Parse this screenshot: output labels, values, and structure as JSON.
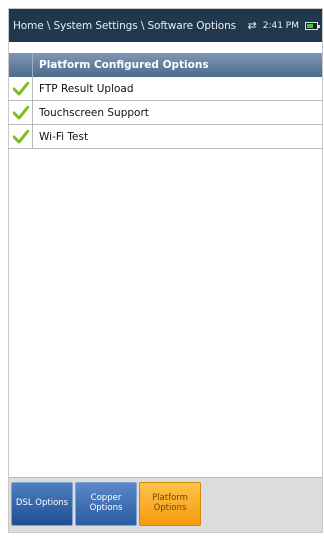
{
  "header": {
    "breadcrumb": "Home \\ System Settings \\ Software Options",
    "time": "2:41 PM",
    "battery_level": 0.7
  },
  "table": {
    "header_label": "Platform Configured Options",
    "rows": [
      {
        "label": "FTP Result Upload",
        "enabled": true
      },
      {
        "label": "Touchscreen Support",
        "enabled": true
      },
      {
        "label": "Wi-Fi Test",
        "enabled": true
      }
    ]
  },
  "tabs": [
    {
      "label": "DSL Options",
      "active": false
    },
    {
      "label": "Copper Options",
      "active": false
    },
    {
      "label": "Platform Options",
      "active": true
    }
  ],
  "colors": {
    "titlebar": "#20384e",
    "check": "#7bbf22",
    "active_tab": "#f6a623",
    "inactive_tab": "#2a5ca3"
  }
}
